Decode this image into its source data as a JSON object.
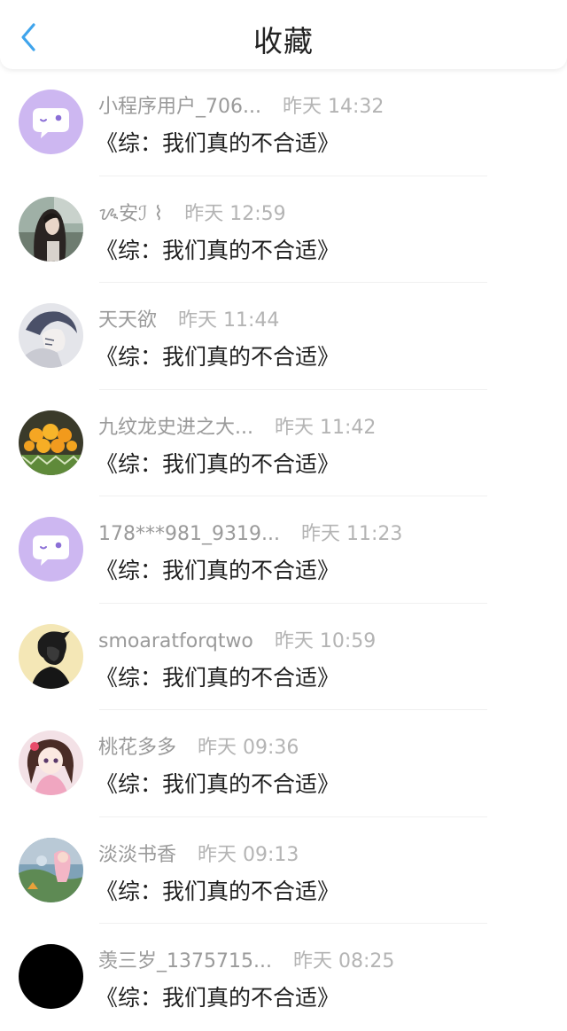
{
  "header": {
    "title": "收藏",
    "back_icon": "chevron-left-icon",
    "accent": "#3fa4ec"
  },
  "favorites": [
    {
      "user": "小程序用户_706...",
      "time": "昨天 14:32",
      "book": "《综：我们真的不合适》",
      "avatar": "chat-bubble-default"
    },
    {
      "user": "ᝰ安ℐ ⌇",
      "time": "昨天 12:59",
      "book": "《综：我们真的不合适》",
      "avatar": "girl-photo"
    },
    {
      "user": "天天欲",
      "time": "昨天 11:44",
      "book": "《综：我们真的不合适》",
      "avatar": "anime-sketch"
    },
    {
      "user": "九纹龙史进之大...",
      "time": "昨天 11:42",
      "book": "《综：我们真的不合适》",
      "avatar": "mango-photo"
    },
    {
      "user": "178***981_9319...",
      "time": "昨天 11:23",
      "book": "《综：我们真的不合适》",
      "avatar": "chat-bubble-default"
    },
    {
      "user": "smoaratforqtwo",
      "time": "昨天 10:59",
      "book": "《综：我们真的不合适》",
      "avatar": "boy-silhouette"
    },
    {
      "user": "桃花多多",
      "time": "昨天 09:36",
      "book": "《综：我们真的不合适》",
      "avatar": "anime-girl-pink"
    },
    {
      "user": "淡淡书香",
      "time": "昨天 09:13",
      "book": "《综：我们真的不合适》",
      "avatar": "anime-scene-forest"
    },
    {
      "user": "羡三岁_1375715...",
      "time": "昨天 08:25",
      "book": "《综：我们真的不合适》",
      "avatar": "black-circle"
    }
  ],
  "colors": {
    "default_avatar_bg": "#cdb7f1",
    "name": "#9a9a9a",
    "time": "#b4b4b4",
    "book": "#1f1f1f"
  }
}
